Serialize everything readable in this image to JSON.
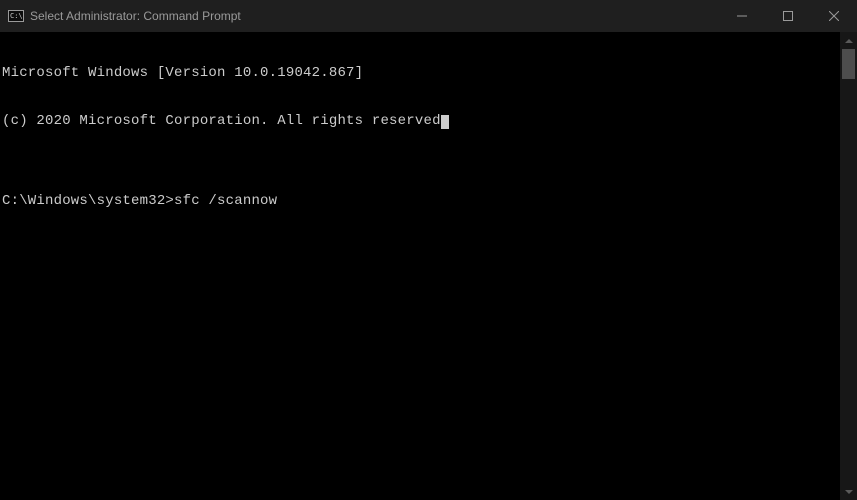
{
  "window": {
    "title": "Select Administrator: Command Prompt"
  },
  "terminal": {
    "line1": "Microsoft Windows [Version 10.0.19042.867]",
    "line2_pre": "(c) 2020 Microsoft Corporation. All rights reserved",
    "line2_post": "",
    "blank": "",
    "prompt": "C:\\Windows\\system32>",
    "command": "sfc /scannow"
  }
}
